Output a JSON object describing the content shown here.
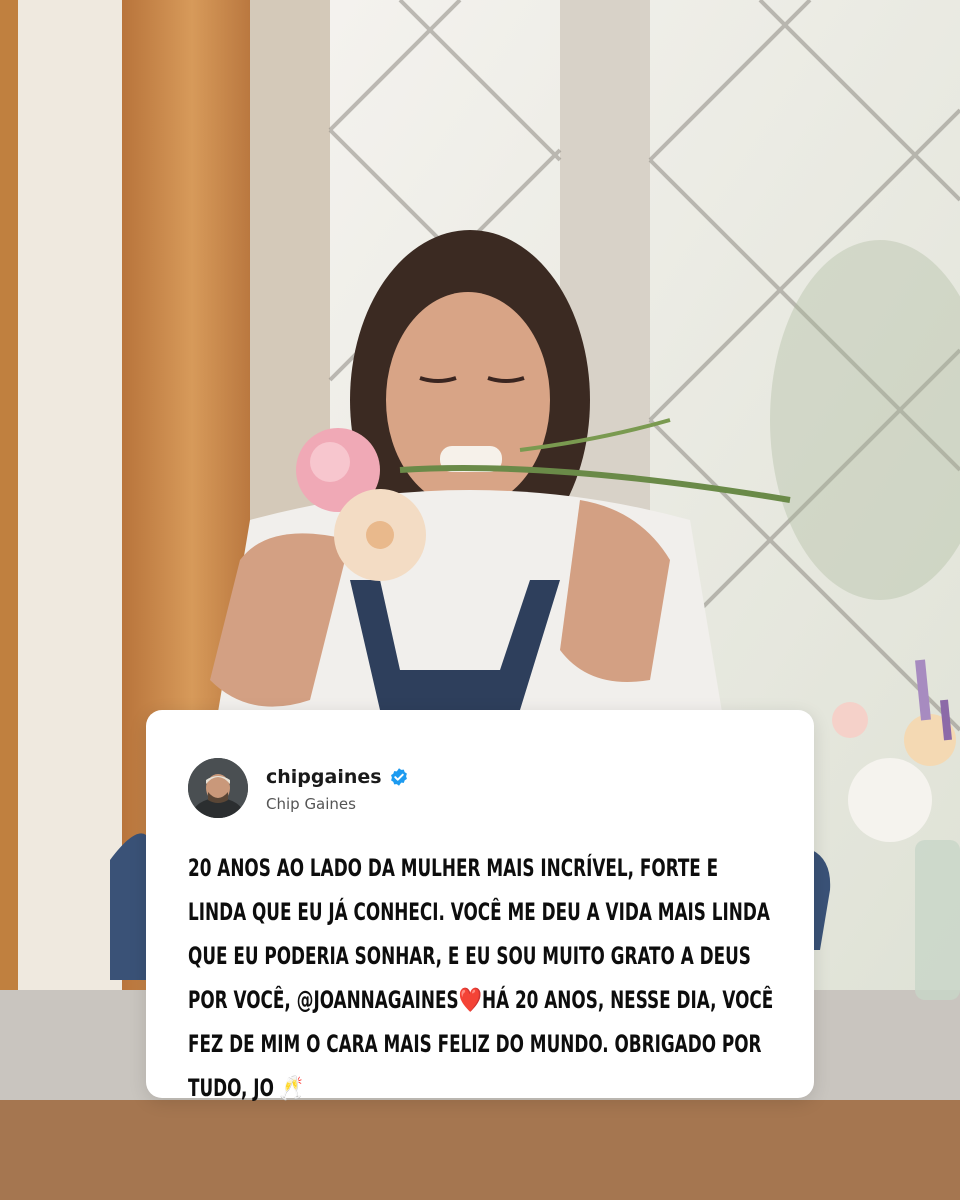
{
  "post": {
    "handle": "chipgaines",
    "display_name": "Chip Gaines",
    "verified": true,
    "text_part1": "20 anos ao lado da mulher mais incrível, forte e linda que eu já conheci. Você me deu a vida mais linda que eu poderia sonhar, e eu sou muito grato a Deus por você, @joannagaines",
    "emoji_heart": "❤️",
    "text_part2": "Há 20 anos, nesse dia, você fez de mim o cara mais feliz do mundo. Obrigado por tudo, Jo",
    "emoji_cheers": "🥂"
  },
  "colors": {
    "verified_blue": "#1d9bf0",
    "card_bg": "#ffffff",
    "text": "#0d0d0d"
  }
}
